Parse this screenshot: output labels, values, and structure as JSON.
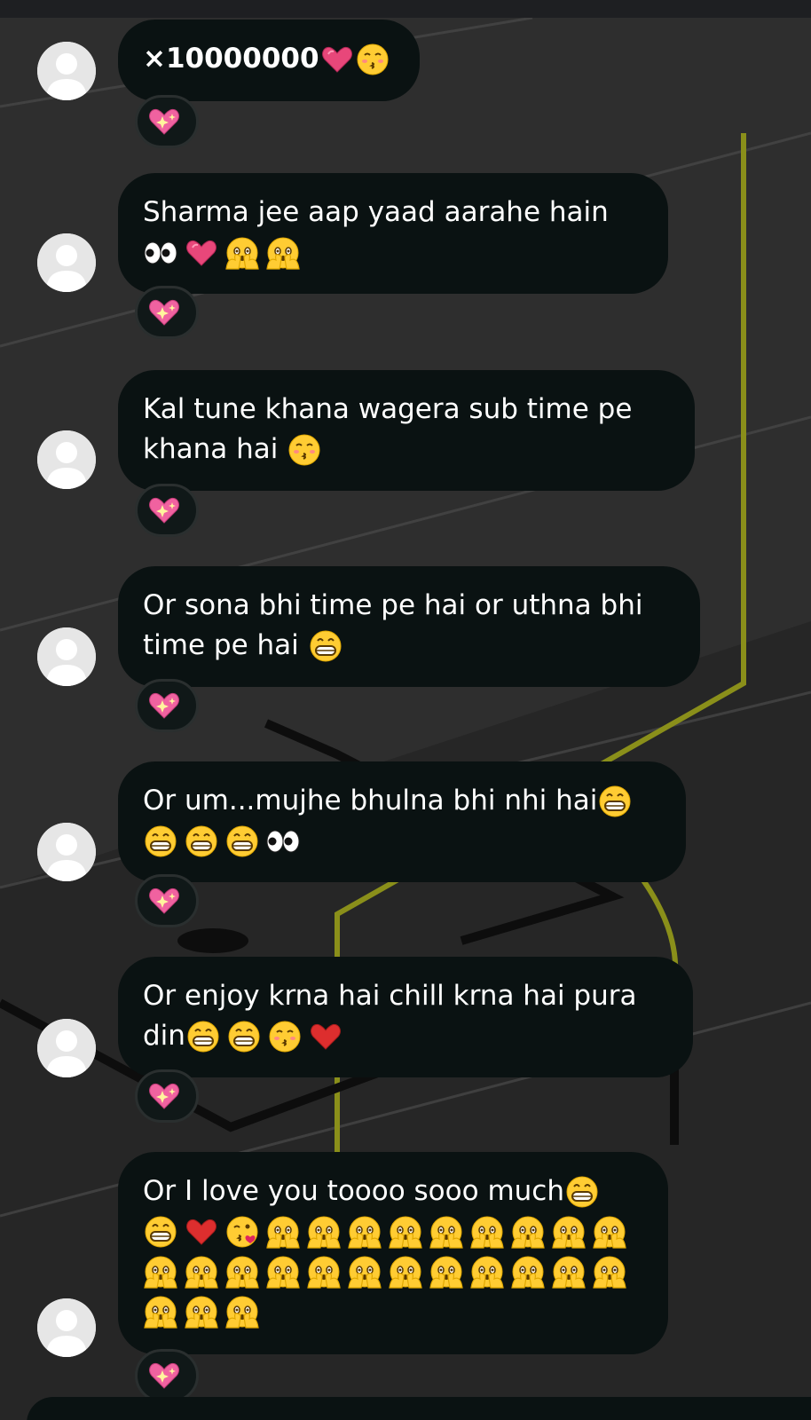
{
  "messages": [
    {
      "text": "×10000000",
      "tail": [
        "pink-heart-icon",
        "kissing-face-icon"
      ],
      "lines": [],
      "reaction": "sparkling-heart-icon"
    },
    {
      "text": "Sharma jee aap yaad aarahe hain",
      "lines": [
        [
          "eyes-icon",
          "pink-heart-icon",
          "face-peeking-icon",
          "face-peeking-icon"
        ]
      ],
      "reaction": "sparkling-heart-icon"
    },
    {
      "text": "Kal tune khana wagera sub time pe",
      "line2": "khana hai",
      "line2_tail": [
        "kissing-face-icon"
      ],
      "reaction": "sparkling-heart-icon"
    },
    {
      "text": "Or sona bhi time pe hai or uthna bhi",
      "line2": "time pe hai",
      "line2_tail": [
        "grinning-face-icon"
      ],
      "reaction": "sparkling-heart-icon"
    },
    {
      "text": "Or um...mujhe bhulna bhi nhi hai",
      "tail": [
        "grinning-face-icon"
      ],
      "lines": [
        [
          "grinning-face-icon",
          "grinning-face-icon",
          "grinning-face-icon",
          "eyes-icon"
        ]
      ],
      "reaction": "sparkling-heart-icon"
    },
    {
      "text": "Or enjoy krna hai chill krna hai pura",
      "line2": "din",
      "line2_tail": [
        "grinning-face-icon",
        "grinning-face-icon",
        "kissing-face-icon",
        "red-heart-icon"
      ],
      "reaction": "sparkling-heart-icon"
    },
    {
      "text": "Or I love you toooo sooo much",
      "tail": [
        "grinning-face-icon"
      ],
      "lines": [
        [
          "grinning-face-icon",
          "red-heart-icon",
          "face-blowing-kiss-icon",
          "face-peeking-icon",
          "face-peeking-icon",
          "face-peeking-icon",
          "face-peeking-icon",
          "face-peeking-icon",
          "face-peeking-icon",
          "face-peeking-icon",
          "face-peeking-icon",
          "face-peeking-icon"
        ],
        [
          "face-peeking-icon",
          "face-peeking-icon",
          "face-peeking-icon",
          "face-peeking-icon",
          "face-peeking-icon",
          "face-peeking-icon",
          "face-peeking-icon",
          "face-peeking-icon",
          "face-peeking-icon",
          "face-peeking-icon",
          "face-peeking-icon",
          "face-peeking-icon"
        ],
        [
          "face-peeking-icon",
          "face-peeking-icon",
          "face-peeking-icon"
        ]
      ],
      "reaction": "sparkling-heart-icon"
    }
  ],
  "colors": {
    "bubble": "#0a1212",
    "background": "#2f2f2f",
    "accent_line": "#8a8f1a"
  }
}
